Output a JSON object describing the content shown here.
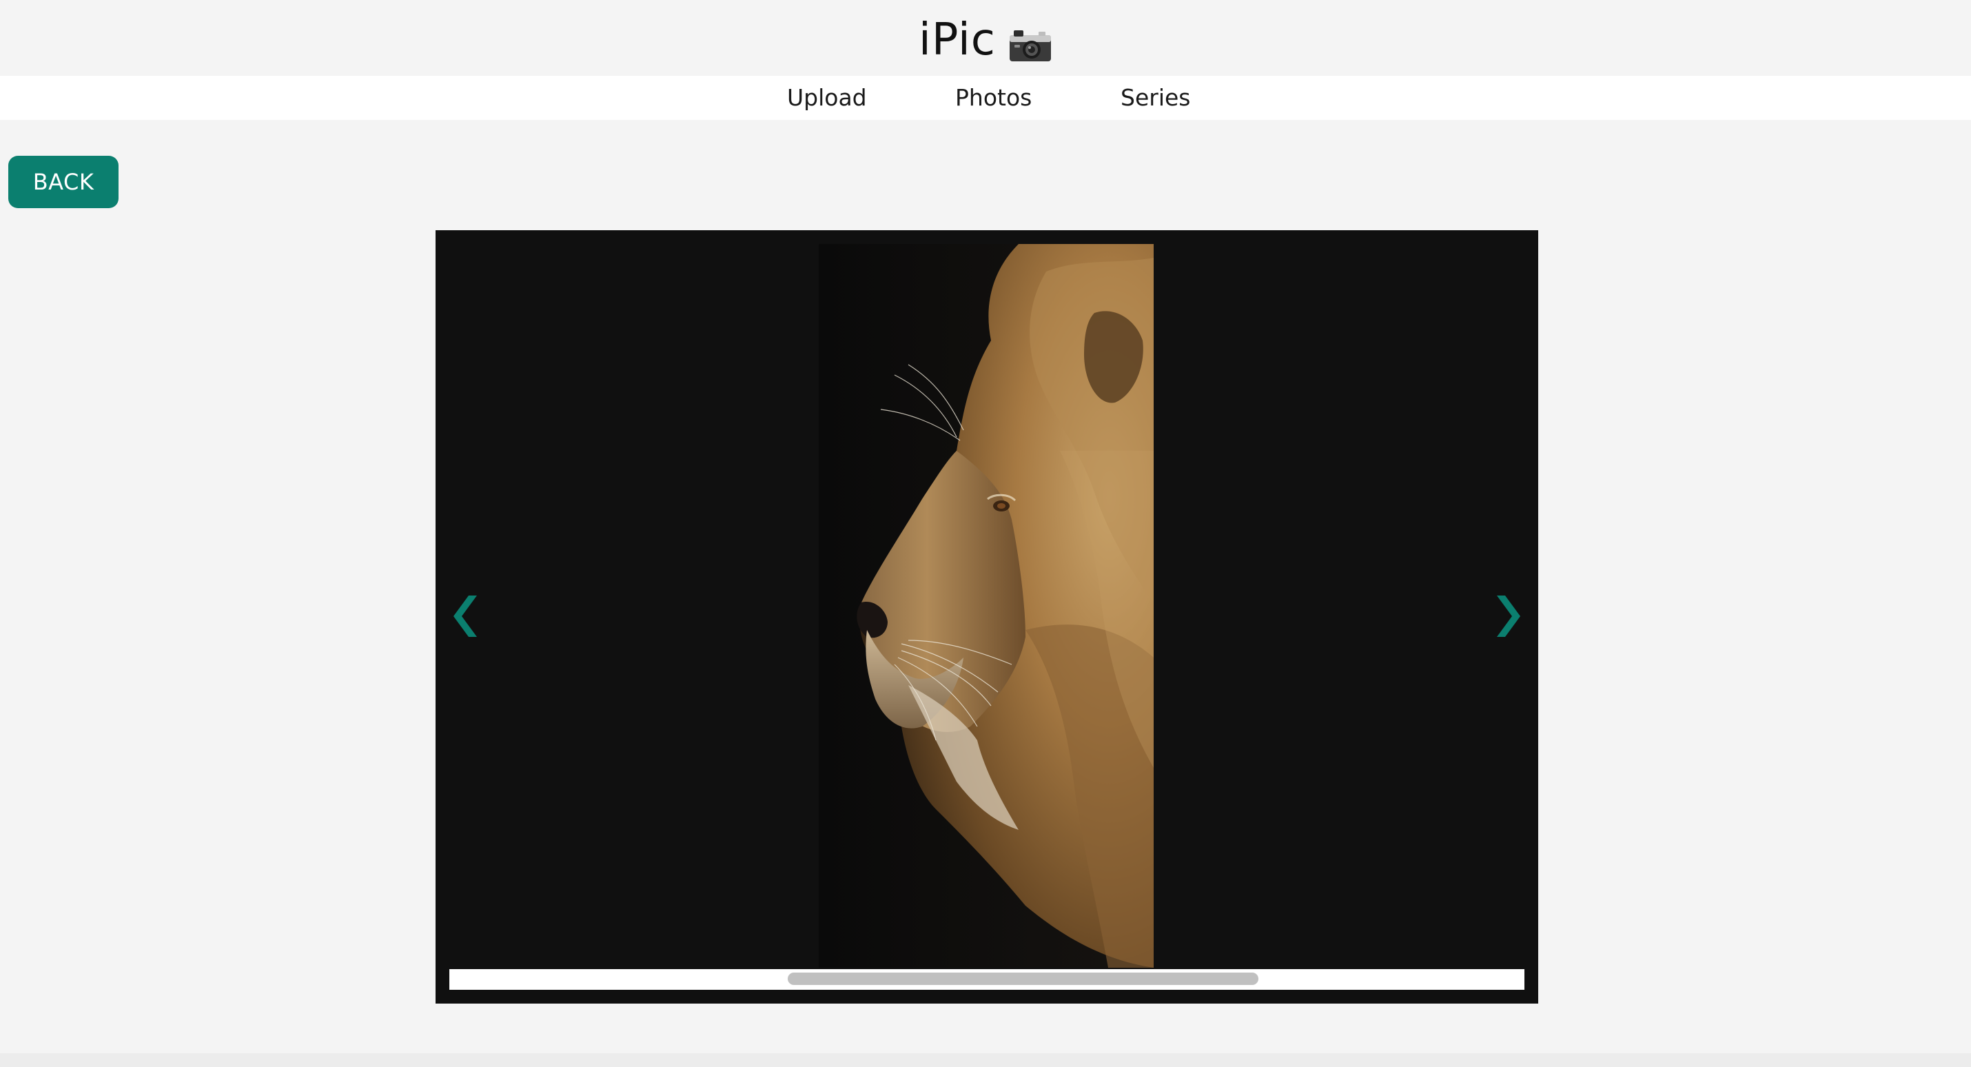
{
  "header": {
    "title": "iPic",
    "logo_icon": "camera-icon"
  },
  "nav": {
    "items": [
      {
        "label": "Upload"
      },
      {
        "label": "Photos"
      },
      {
        "label": "Series"
      }
    ]
  },
  "back_button": {
    "label": "BACK"
  },
  "viewer": {
    "photo_subject": "lion-profile-photo",
    "prev_icon": "chevron-left-icon",
    "next_icon": "chevron-right-icon",
    "scroll_position_fraction": 0.56,
    "scroll_thumb_fraction": 0.44
  },
  "colors": {
    "accent": "#0b7f6f",
    "page_background": "#f4f4f4",
    "nav_background": "#ffffff",
    "viewer_background": "#101010",
    "scroll_thumb": "#c0c0c0"
  }
}
